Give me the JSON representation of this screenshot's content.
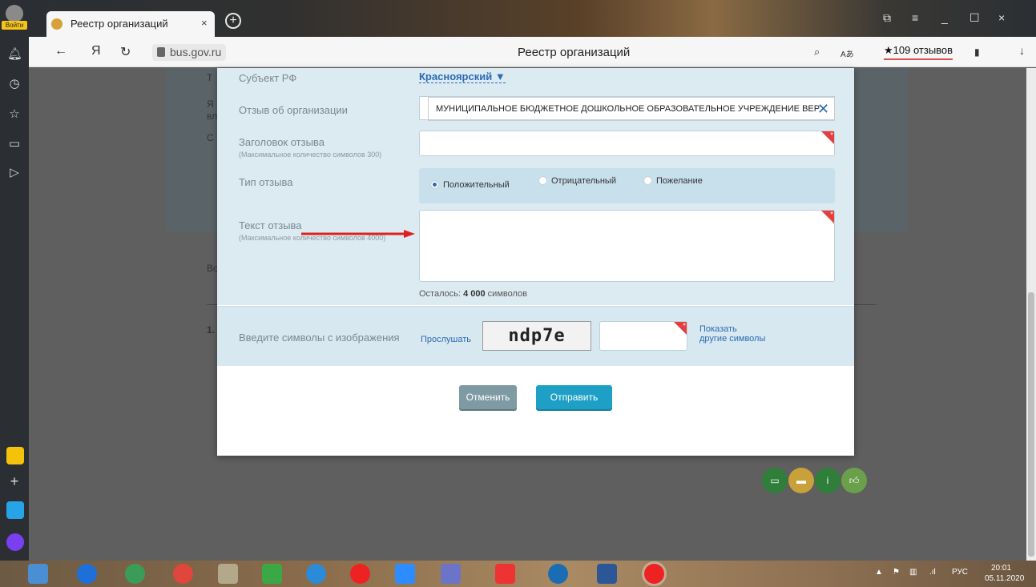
{
  "browser": {
    "login_label": "Войти",
    "tab_title": "Реестр организаций",
    "tab_close": "×",
    "new_tab": "+",
    "url": "bus.gov.ru",
    "page_title": "Реестр организаций",
    "reviews_badge": "★109 отзывов",
    "window_controls": [
      "⧉",
      "≡",
      "_",
      "☐",
      "×"
    ]
  },
  "modal": {
    "subject_label": "Субъект РФ",
    "subject_value": "Красноярский ▼",
    "org_label": "Отзыв об организации",
    "org_value": "МУНИЦИПАЛЬНОЕ БЮДЖЕТНОЕ ДОШКОЛЬНОЕ ОБРАЗОВАТЕЛЬНОЕ УЧРЕЖДЕНИЕ ВЕР",
    "title_label": "Заголовок отзыва",
    "title_hint": "(Максимальное количество символов 300)",
    "type_label": "Тип отзыва",
    "types": [
      "Положительный",
      "Отрицательный",
      "Пожелание"
    ],
    "text_label": "Текст отзыва",
    "text_hint": "(Максимальное количество символов 4000)",
    "remaining_prefix": "Осталось: ",
    "remaining_count": "4 000",
    "remaining_suffix": " символов",
    "captcha_label": "Введите символы с изображения",
    "listen": "Прослушать",
    "captcha_text": "ndp7e",
    "other_line1": "Показать",
    "other_line2": "другие символы",
    "cancel": "Отменить",
    "send": "Отправить"
  },
  "page_bg": {
    "fragments": [
      "Т",
      "Я",
      "вл",
      "С",
      "Во",
      "1."
    ]
  },
  "tray": {
    "lang": "РУС",
    "time": "20:01",
    "date": "05.11.2020"
  },
  "colors": {
    "accent": "#1ea0c6",
    "link": "#2b6bb3",
    "required": "#e53e3e"
  }
}
